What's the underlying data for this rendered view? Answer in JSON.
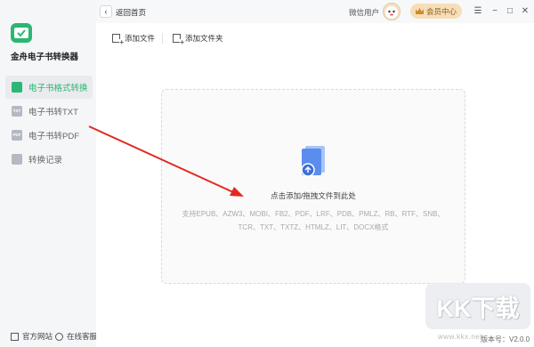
{
  "colors": {
    "accent": "#2bb673",
    "arrow": "#e0281f",
    "file_icon": "#5b8def"
  },
  "sidebar": {
    "app_title": "金舟电子书转换器",
    "items": [
      {
        "label": "电子书格式转换",
        "icon": "convert-icon",
        "active": true
      },
      {
        "label": "电子书转TXT",
        "icon": "txt-icon",
        "icon_text": "TXT",
        "active": false
      },
      {
        "label": "电子书转PDF",
        "icon": "pdf-icon",
        "icon_text": "PDF",
        "active": false
      },
      {
        "label": "转换记录",
        "icon": "history-icon",
        "active": false
      }
    ],
    "footer": {
      "website": "官方网站",
      "support": "在线客服"
    }
  },
  "header": {
    "back_label": "返回首页",
    "user_name": "微信用户",
    "vip_label": "会员中心",
    "window_controls": [
      "menu-icon",
      "minimize-icon",
      "maximize-icon",
      "close-icon"
    ]
  },
  "toolbar": {
    "add_file": "添加文件",
    "add_folder": "添加文件夹"
  },
  "dropzone": {
    "hint": "点击添加/拖拽文件到此处",
    "formats_line1": "支持EPUB、AZW3、MOBI、FB2、PDF、LRF、PDB、PMLZ、RB、RTF、SNB、",
    "formats_line2": "TCR、TXT、TXTZ、HTMLZ、LIT、DOCX格式"
  },
  "version_text": "版本号：V2.0.0",
  "watermark": {
    "text": "KK下载",
    "url": "www.kkx.net"
  }
}
